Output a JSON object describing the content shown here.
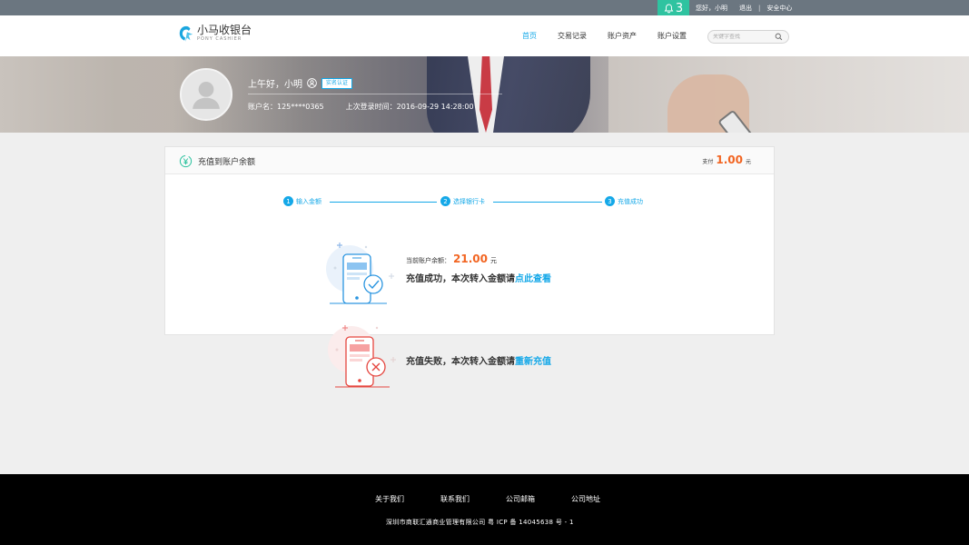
{
  "topbar": {
    "notification_count": "3",
    "greeting": "您好，小明",
    "logout": "退出",
    "separator": "|",
    "security_center": "安全中心"
  },
  "header": {
    "logo_cn": "小马收银台",
    "logo_en": "PONY CASHIER",
    "nav": [
      {
        "label": "首页",
        "active": true
      },
      {
        "label": "交易记录",
        "active": false
      },
      {
        "label": "账户资产",
        "active": false
      },
      {
        "label": "账户设置",
        "active": false
      }
    ],
    "search_placeholder": "关键字查找"
  },
  "profile": {
    "greeting": "上午好，小明",
    "verified_badge": "实名认证",
    "account_name": "账户名：125****0365",
    "last_login": "上次登录时间：2016-09-29 14:28:00"
  },
  "panel": {
    "title": "充值到账户余额",
    "pay_label": "支付",
    "pay_amount": "1.00",
    "pay_unit": "元"
  },
  "steps": [
    {
      "num": "1",
      "label": "输入金额"
    },
    {
      "num": "2",
      "label": "选择银行卡"
    },
    {
      "num": "3",
      "label": "充值成功"
    }
  ],
  "success": {
    "balance_label": "当前账户余额：",
    "balance_amount": "21.00",
    "balance_unit": "元",
    "message": "充值成功，本次转入金额请",
    "link": "点此查看"
  },
  "failure": {
    "message": "充值失败，本次转入金额请",
    "link": "重新充值"
  },
  "footer": {
    "links": [
      "关于我们",
      "联系我们",
      "公司邮箱",
      "公司地址"
    ],
    "copyright": "深圳市商联汇通商业管理有限公司    粤 ICP 备 14045638 号 - 1"
  },
  "colors": {
    "accent": "#14a8e8",
    "orange": "#f26522",
    "bell_bg": "#2fc3a0",
    "topbar_bg": "#6b7680"
  }
}
